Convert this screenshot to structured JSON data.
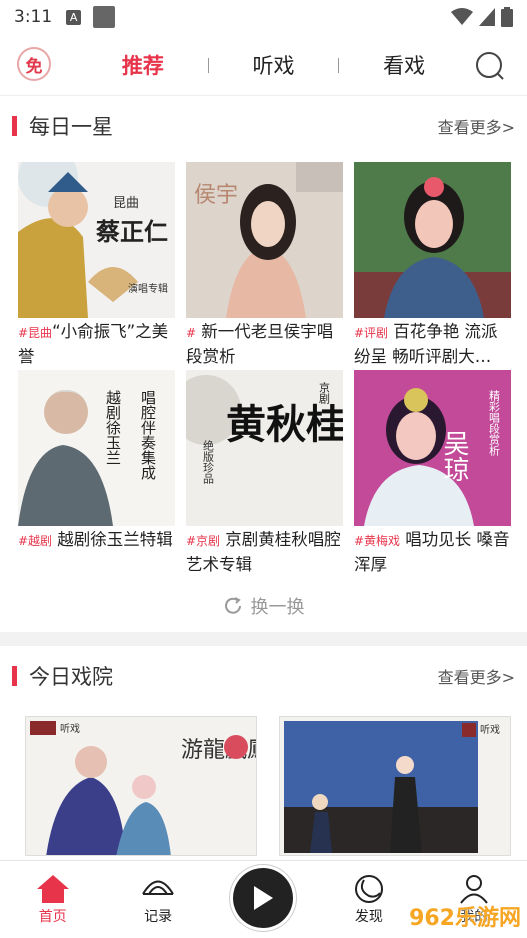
{
  "status": {
    "time": "3:11",
    "a_icon": "A"
  },
  "logo": {
    "text": "免"
  },
  "tabs": [
    "推荐",
    "听戏",
    "看戏"
  ],
  "section1": {
    "title": "每日一星",
    "more": "查看更多>"
  },
  "star_cards": [
    {
      "tag": "#昆曲",
      "title": "“小俞振飞”之美誉",
      "img_title": "蔡正仁",
      "img_sub": "昆曲",
      "img_note": "演唱专辑"
    },
    {
      "tag": "#",
      "title": " 新一代老旦侯宇唱段赏析",
      "img_title": "侯宇"
    },
    {
      "tag": "#评剧",
      "title": " 百花争艳 流派纷呈 畅听评剧大…"
    },
    {
      "tag": "#越剧",
      "title": " 越剧徐玉兰特辑",
      "img_title": "越剧徐玉兰",
      "img_note": "唱腔伴奏集成"
    },
    {
      "tag": "#京剧",
      "title": " 京剧黄桂秋唱腔艺术专辑",
      "img_title": "黄秋桂",
      "img_sub": "京剧",
      "img_note": "绝版珍品"
    },
    {
      "tag": "#黄梅戏",
      "title": " 唱功见长 嗓音浑厚",
      "img_title": "吴琼",
      "img_note": "精彩唱段赏析"
    }
  ],
  "refresh": "换一换",
  "section2": {
    "title": "今日戏院",
    "more": "查看更多>"
  },
  "theater_cards": [
    {
      "img_title": "游龍戲鳳",
      "badge": "听戏"
    },
    {
      "badge": "听戏"
    }
  ],
  "bottom_nav": [
    "首页",
    "记录",
    "发现",
    "我的"
  ],
  "watermark": "962乐游网"
}
